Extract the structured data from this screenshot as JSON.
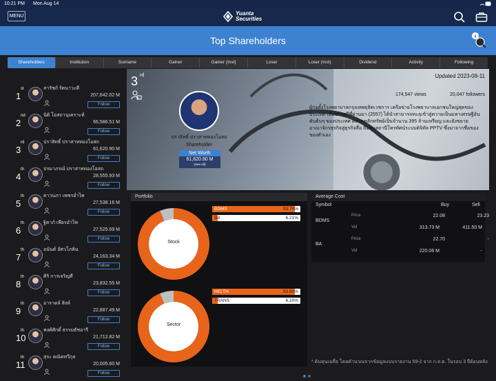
{
  "status": {
    "time": "10:21 PM",
    "date": "Mon Aug 14",
    "battery": "▮"
  },
  "header": {
    "menu_label": "MENU",
    "logo_line1": "Yuanta",
    "logo_line2": "Securities",
    "title": "Top Shareholders"
  },
  "tabs": [
    {
      "label": "Shareholders",
      "active": true
    },
    {
      "label": "Institution"
    },
    {
      "label": "Surname"
    },
    {
      "label": "Gainer"
    },
    {
      "label": "Gainer (Inst)"
    },
    {
      "label": "Loser"
    },
    {
      "label": "Loser (Inst)"
    },
    {
      "label": "Dividend"
    },
    {
      "label": "Activity"
    },
    {
      "label": "Following"
    }
  ],
  "shareholders": [
    {
      "rank": "1",
      "suffix": "st",
      "name": "สารัชถ์ รัตนาวะดี",
      "value": "207,642.02 M",
      "follow": "Follow"
    },
    {
      "rank": "2",
      "suffix": "nd",
      "name": "นิติ โอสถานุเคราะห์",
      "value": "66,586.51 M",
      "follow": "Follow"
    },
    {
      "rank": "3",
      "suffix": "rd",
      "name": "ปราสิทธิ์ ปราสาททองโอสถ",
      "value": "61,620.90 M",
      "follow": "Follow"
    },
    {
      "rank": "4",
      "suffix": "th",
      "name": "ปรมาภรณ์ ปราสาททองโอสถ",
      "value": "28,555.93 M",
      "follow": "Follow"
    },
    {
      "rank": "5",
      "suffix": "th",
      "name": "ดาวนภา เพชรอำไพ",
      "value": "27,538.16 M",
      "follow": "Follow"
    },
    {
      "rank": "6",
      "suffix": "th",
      "name": "ฐิตาภ์ เพียรอำไพ",
      "value": "27,525.69 M",
      "follow": "Follow"
    },
    {
      "rank": "7",
      "suffix": "th",
      "name": "อนันต์ อัศวโภคิน",
      "value": "24,163.34 M",
      "follow": "Follow"
    },
    {
      "rank": "8",
      "suffix": "th",
      "name": "ศิริ การเจริญดี",
      "value": "23,832.55 M",
      "follow": "Follow"
    },
    {
      "rank": "9",
      "suffix": "th",
      "name": "อาราดล์ สิงห์",
      "value": "22,887.49 M",
      "follow": "Follow"
    },
    {
      "rank": "10",
      "suffix": "th",
      "name": "พงศ์ศักดิ์ ธรรมธัชอารี",
      "value": "21,712.82 M",
      "follow": "Follow"
    },
    {
      "rank": "11",
      "suffix": "th",
      "name": "สุระ คณิตทวีกุล",
      "value": "20,005.60 M",
      "follow": "Follow"
    }
  ],
  "profile": {
    "rank": "3",
    "suffix": "rd",
    "name": "ปราสิทธิ์ ปราสาททองโอสถ",
    "role": "Shareholder",
    "networth_label": "Net Worth",
    "networth_value": "61,620.90 M",
    "see_all": "(See All)",
    "updated": "Updated 2023-08-11",
    "views": "174,547 views",
    "followers": "20,047 followers",
    "bio": "ผู้ก่อตั้งโรงพยาบาลกรุงเทพดุสิตเวชการ เครือข่ายโรงพยาบาลเอกชนใหญ่สุดของประเทศ เมื่อปลายปีที่ผ่านมา (2557) ได้นำสามารถทะลุเข้าสู่ความเป็นมหาเศรษฐีอันดับต้นๆ ของประเทศ ตลาดหลักทรัพย์เป็นจำนวน 395 ล้านเหรียญ และยังขยายอาณาจักรธุรกิจสู่ธุรกิจสื่อ ถือหุ้นสถานีโทรทัศน์ระบบดิจิทัล PPTV ซึ่งมาจากชื่อของของตัวเอง"
  },
  "portfolio": {
    "title": "Portfolio",
    "stock_label": "Stock",
    "sector_label": "Sector",
    "stock": [
      {
        "name": "BDMS",
        "pct": 93.79,
        "label": "93.79%"
      },
      {
        "name": "BA",
        "pct": 6.21,
        "label": "6.21%"
      }
    ],
    "sector": [
      {
        "name": "HELTH",
        "pct": 93.8,
        "label": "93.80%"
      },
      {
        "name": "TRANS",
        "pct": 6.2,
        "label": "6.20%"
      }
    ]
  },
  "avg_cost": {
    "title": "Average Cost",
    "col_symbol": "Symbol",
    "col_buy": "Buy",
    "col_sell": "Sell",
    "price_label": "Price",
    "vol_label": "Vol",
    "rows": [
      {
        "symbol": "BDMS",
        "price_buy": "22.08",
        "price_sell": "23.23",
        "vol_buy": "313.73 M",
        "vol_sell": "411.50 M"
      },
      {
        "symbol": "BA",
        "price_buy": "22.70",
        "price_sell": "-",
        "vol_buy": "220.06 M",
        "vol_sell": "-"
      }
    ],
    "footnote": "* ต้นทุนเฉลี่ย โดยคำนวณจากข้อมูลแบบรายงาน 59-2 จาก ก.ล.ต. ในรอบ 3 ปีย้อนหลัง"
  },
  "colors": {
    "accent": "#3d82d0",
    "navy": "#16284c",
    "orange": "#e8641a"
  }
}
